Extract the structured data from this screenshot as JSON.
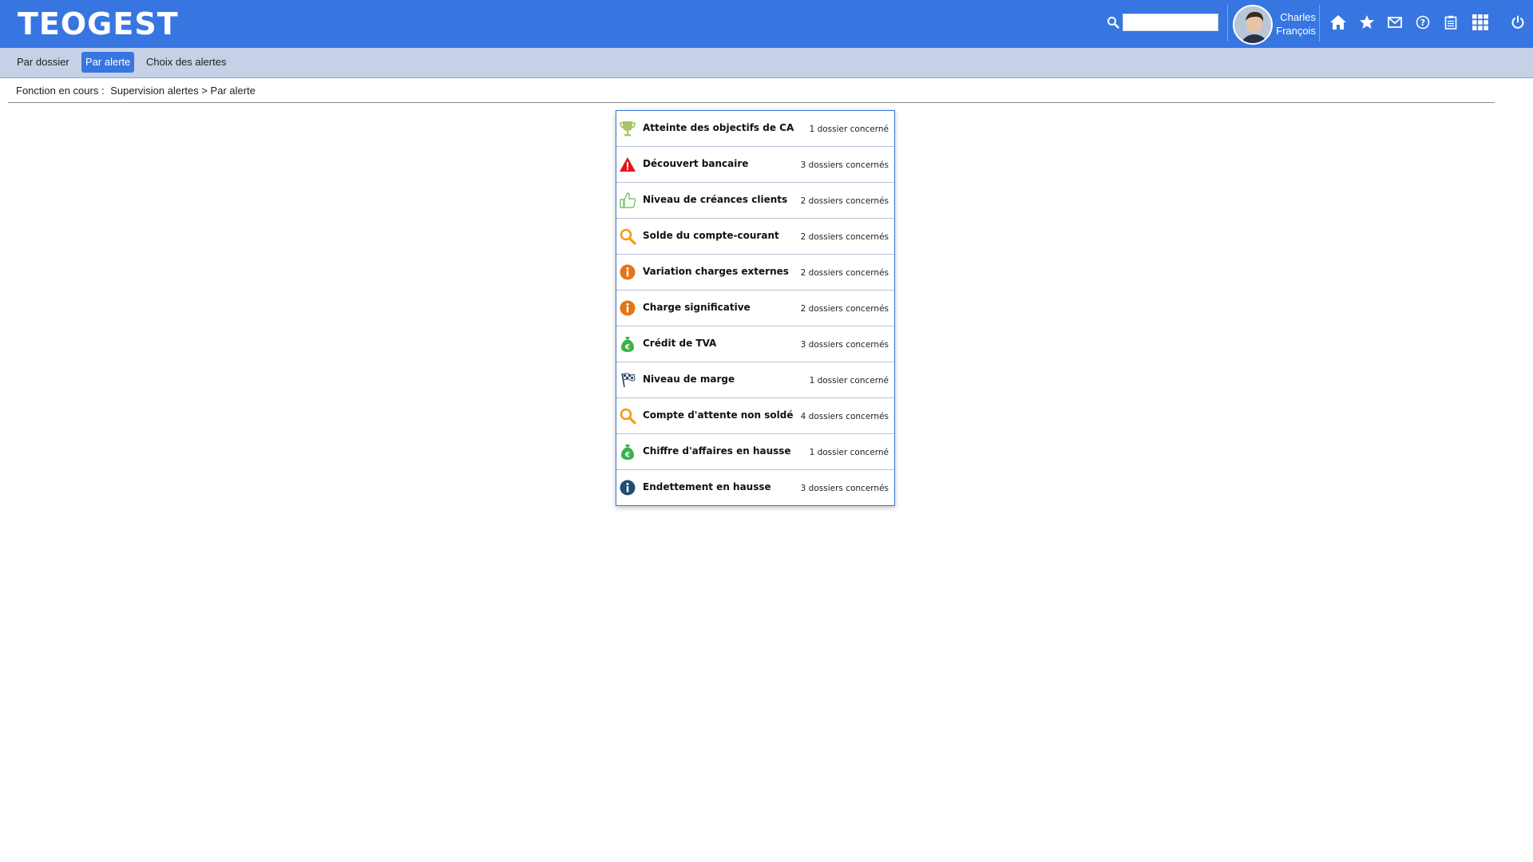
{
  "header": {
    "logo": "TEOGEST",
    "search": {
      "value": "",
      "placeholder": ""
    },
    "user": {
      "first_name": "Charles",
      "last_name": "François"
    },
    "icons": [
      "home-icon",
      "star-icon",
      "mail-icon",
      "help-icon",
      "clipboard-icon",
      "apps-grid-icon",
      "power-icon"
    ],
    "accent_color": "#3776e1"
  },
  "subnav": {
    "tabs": [
      {
        "label": "Par dossier",
        "active": false
      },
      {
        "label": "Par alerte",
        "active": true
      },
      {
        "label": "Choix des alertes",
        "active": false
      }
    ]
  },
  "breadcrumb": {
    "prefix": "Fonction en cours :",
    "path": "Supervision alertes > Par alerte"
  },
  "alerts": [
    {
      "icon": "trophy-icon",
      "label": "Atteinte des objectifs de CA",
      "count": "1 dossier concerné"
    },
    {
      "icon": "warning-triangle-icon",
      "label": "Découvert bancaire",
      "count": "3 dossiers concernés"
    },
    {
      "icon": "thumbs-up-icon",
      "label": "Niveau de créances clients",
      "count": "2 dossiers concernés"
    },
    {
      "icon": "magnifier-icon",
      "label": "Solde du compte-courant",
      "count": "2 dossiers concernés"
    },
    {
      "icon": "info-orange-icon",
      "label": "Variation charges externes",
      "count": "2 dossiers concernés"
    },
    {
      "icon": "info-orange-icon",
      "label": "Charge significative",
      "count": "2 dossiers concernés"
    },
    {
      "icon": "money-bag-icon",
      "label": "Crédit de TVA",
      "count": "3 dossiers concernés"
    },
    {
      "icon": "checkered-flag-icon",
      "label": "Niveau de marge",
      "count": "1 dossier concerné"
    },
    {
      "icon": "magnifier-icon",
      "label": "Compte d'attente non soldé",
      "count": "4 dossiers concernés"
    },
    {
      "icon": "money-bag-icon",
      "label": "Chiffre d'affaires en hausse",
      "count": "1 dossier concerné"
    },
    {
      "icon": "info-blue-icon",
      "label": "Endettement en hausse",
      "count": "3 dossiers concernés"
    }
  ]
}
